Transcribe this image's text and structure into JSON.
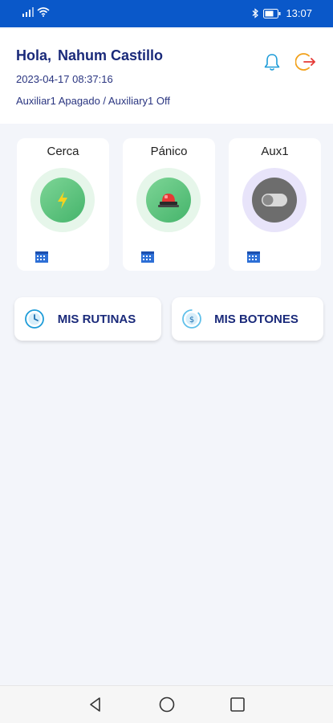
{
  "status_bar": {
    "time": "13:07"
  },
  "header": {
    "greeting": "Hola,",
    "user_name": "Nahum Castillo",
    "datetime": "2023-04-17 08:37:16",
    "status_text": "Auxiliar1 Apagado / Auxiliary1 Off"
  },
  "cards": [
    {
      "title": "Cerca",
      "icon": "lightning-icon"
    },
    {
      "title": "Pánico",
      "icon": "siren-icon"
    },
    {
      "title": "Aux1",
      "icon": "toggle-off-icon"
    }
  ],
  "actions": {
    "routines_label": "MIS RUTINAS",
    "buttons_label": "MIS BOTONES"
  },
  "colors": {
    "status_bar": "#0a58c9",
    "primary_text": "#1a2a7a",
    "green": "#56c27b",
    "panic_red": "#e53935",
    "aux_gray": "#6d6d6d",
    "aux_halo": "#e8e4fa"
  }
}
